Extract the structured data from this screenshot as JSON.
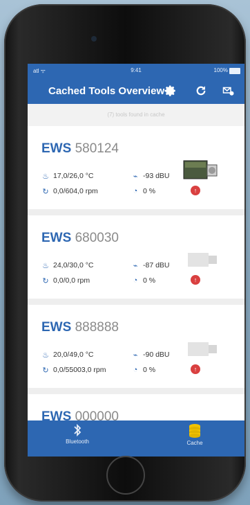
{
  "status": {
    "signal": "atl ᯤ",
    "time": "9:41",
    "battery": "100%"
  },
  "nav": {
    "title": "Cached Tools Overview"
  },
  "subheader": "(7) tools found in cache",
  "tools": [
    {
      "prefix": "EWS",
      "number": "580124",
      "temp": "17,0/26,0 °C",
      "signal": "-93 dBU",
      "rpm": "0,0/604,0 rpm",
      "percent": "0 %"
    },
    {
      "prefix": "EWS",
      "number": "680030",
      "temp": "24,0/30,0 °C",
      "signal": "-87 dBU",
      "rpm": "0,0/0,0 rpm",
      "percent": "0 %"
    },
    {
      "prefix": "EWS",
      "number": "888888",
      "temp": "20,0/49,0 °C",
      "signal": "-90 dBU",
      "rpm": "0,0/55003,0 rpm",
      "percent": "0 %"
    },
    {
      "prefix": "EWS",
      "number": "000000"
    }
  ],
  "tabs": [
    {
      "label": "Bluetooth",
      "icon": "bluetooth-icon"
    },
    {
      "label": "Cache",
      "icon": "database-icon"
    }
  ],
  "colors": {
    "primary": "#2d67b2",
    "warning": "#d94040"
  }
}
